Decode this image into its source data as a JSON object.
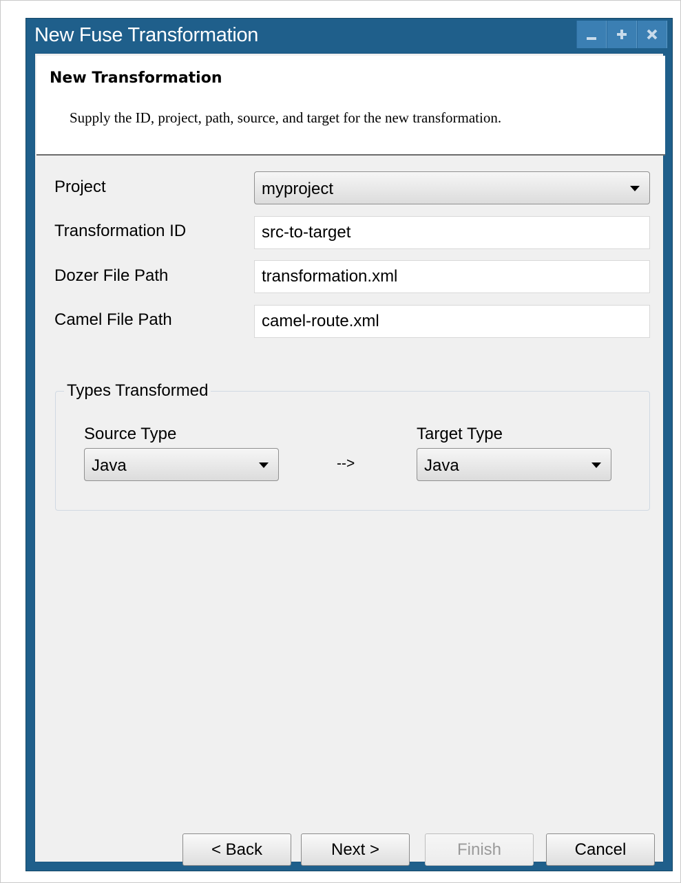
{
  "window": {
    "title": "New Fuse Transformation",
    "colors": {
      "frame": "#1f5f8b",
      "client": "#f0f0f0"
    }
  },
  "banner": {
    "title": "New Transformation",
    "description": "Supply the ID, project, path, source, and target for the new transformation."
  },
  "form": {
    "project": {
      "label": "Project",
      "value": "myproject"
    },
    "transformation_id": {
      "label": "Transformation ID",
      "value": "src-to-target"
    },
    "dozer_path": {
      "label": "Dozer File Path",
      "value": "transformation.xml"
    },
    "camel_path": {
      "label": "Camel File Path",
      "value": "camel-route.xml"
    }
  },
  "types": {
    "legend": "Types Transformed",
    "source_label": "Source Type",
    "source_value": "Java",
    "arrow": "-->",
    "target_label": "Target Type",
    "target_value": "Java"
  },
  "buttons": {
    "back": "< Back",
    "next": "Next >",
    "finish": "Finish",
    "cancel": "Cancel"
  }
}
